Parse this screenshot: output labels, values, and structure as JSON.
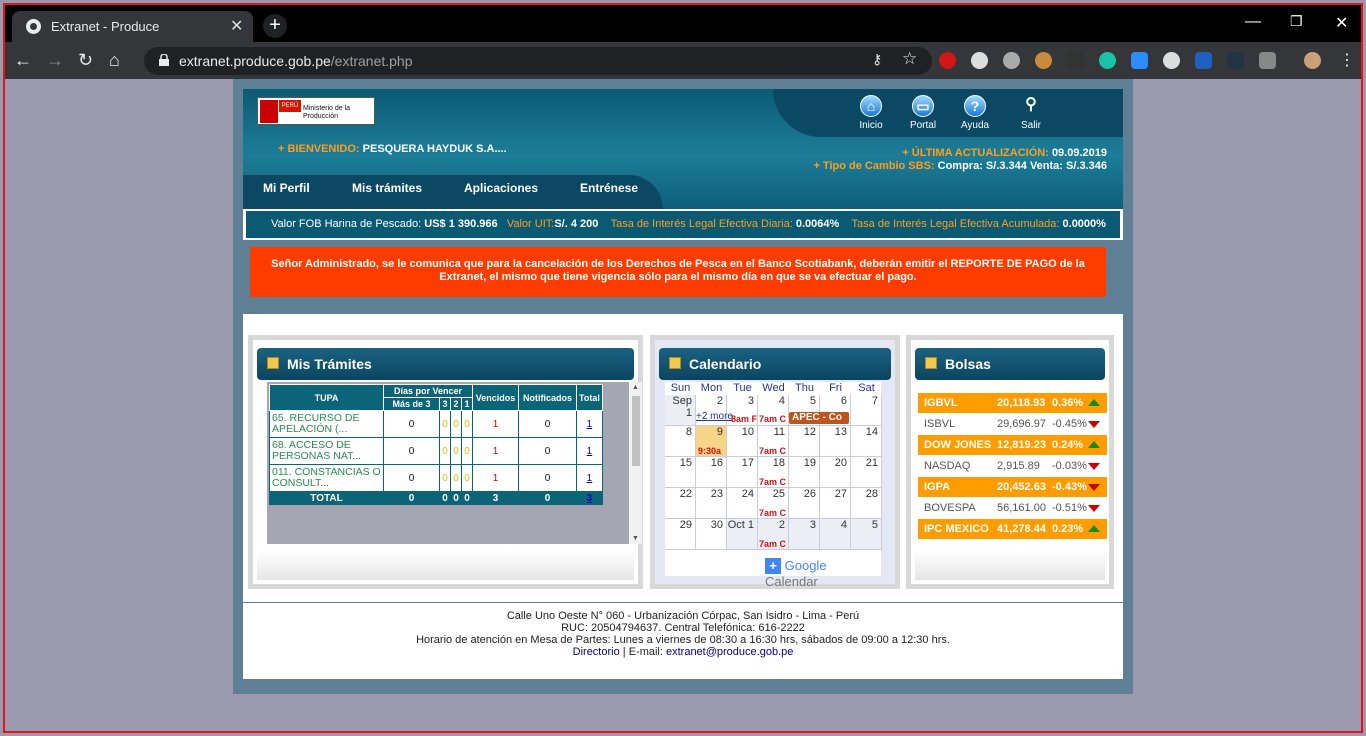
{
  "browser": {
    "tab_title": "Extranet - Produce",
    "url_host": "extranet.produce.gob.pe",
    "url_path": "/extranet.php"
  },
  "header": {
    "logo_text": "Ministerio de la Producción",
    "logo_country": "PERÚ",
    "icons": [
      {
        "label": "Inicio"
      },
      {
        "label": "Portal"
      },
      {
        "label": "Ayuda"
      },
      {
        "label": "Salir"
      }
    ],
    "welcome_prefix": "+ BIENVENIDO:",
    "welcome_name": "PESQUERA HAYDUK S.A....",
    "update_prefix": "+ ÚLTIMA ACTUALIZACIÓN:",
    "update_date": "09.09.2019",
    "fx_prefix": "+ Tipo de Cambio SBS:",
    "fx_value": "Compra: S/.3.344 Venta: S/.3.346"
  },
  "menu": [
    "Mi Perfil",
    "Mis trámites",
    "Aplicaciones",
    "Entrénese"
  ],
  "ticker": {
    "fob_label": "Valor FOB Harina de Pescado:",
    "fob_value": "US$ 1 390.966",
    "uit_label": "Valor UIT:",
    "uit_value": "S/. 4 200",
    "tasa1_label": "Tasa de Interés Legal Efectiva Diaria:",
    "tasa1_value": "0.0064%",
    "tasa2_label": "Tasa de Interés Legal Efectiva Acumulada:",
    "tasa2_value": "0.0000%"
  },
  "notice": "Señor Administrado, se le comunica que para la cancelación de los Derechos de Pesca en el Banco Scotiabank, deberán emitir el REPORTE DE PAGO de la Extranet, el mismo que tiene vigencia sólo para el mismo día en que se va efectuar el pago.",
  "tramites": {
    "title": "Mis Trámites",
    "headers": {
      "tupa": "TUPA",
      "dias": "Días por Vencer",
      "mas3": "Más de 3",
      "d3": "3",
      "d2": "2",
      "d1": "1",
      "vencidos": "Vencidos",
      "notificados": "Notificados",
      "total": "Total"
    },
    "rows": [
      {
        "name": "65. RECURSO DE APELACIÓN (...",
        "mas3": "0",
        "d3": "0",
        "d2": "0",
        "d1": "0",
        "venc": "1",
        "notif": "0",
        "total": "1"
      },
      {
        "name": "68. ACCESO DE PERSONAS NAT...",
        "mas3": "0",
        "d3": "0",
        "d2": "0",
        "d1": "0",
        "venc": "1",
        "notif": "0",
        "total": "1"
      },
      {
        "name": "011. CONSTANCIAS O CONSULT...",
        "mas3": "0",
        "d3": "0",
        "d2": "0",
        "d1": "0",
        "venc": "1",
        "notif": "0",
        "total": "1"
      }
    ],
    "totals": {
      "label": "TOTAL",
      "mas3": "0",
      "d3": "0",
      "d2": "0",
      "d1": "0",
      "venc": "3",
      "notif": "0",
      "total": "3"
    }
  },
  "calendario": {
    "title": "Calendario",
    "days": [
      "Sun",
      "Mon",
      "Tue",
      "Wed",
      "Thu",
      "Fri",
      "Sat"
    ],
    "weeks": [
      [
        "Sep 1",
        "2",
        "3",
        "4",
        "5",
        "6",
        "7"
      ],
      [
        "8",
        "9",
        "10",
        "11",
        "12",
        "13",
        "14"
      ],
      [
        "15",
        "16",
        "17",
        "18",
        "19",
        "20",
        "21"
      ],
      [
        "22",
        "23",
        "24",
        "25",
        "26",
        "27",
        "28"
      ],
      [
        "29",
        "30",
        "Oct 1",
        "2",
        "3",
        "4",
        "5"
      ]
    ],
    "events": {
      "more": "+2 more",
      "e1": "8am F",
      "e2": "7am C",
      "apec": "APEC - Co",
      "e930": "9:30a"
    },
    "google": "Google",
    "calendar": "Calendar"
  },
  "bolsas": {
    "title": "Bolsas",
    "rows": [
      {
        "name": "IGBVL",
        "value": "20,118.93",
        "pct": "0.36%",
        "dir": "up",
        "style": "o"
      },
      {
        "name": "ISBVL",
        "value": "29,696.97",
        "pct": "-0.45%",
        "dir": "dn",
        "style": "w"
      },
      {
        "name": "DOW JONES",
        "value": "12,819.23",
        "pct": "0.24%",
        "dir": "up",
        "style": "o"
      },
      {
        "name": "NASDAQ",
        "value": "2,915.89",
        "pct": "-0.03%",
        "dir": "dn",
        "style": "w"
      },
      {
        "name": "IGPA",
        "value": "20,452.63",
        "pct": "-0.43%",
        "dir": "dn",
        "style": "o"
      },
      {
        "name": "BOVESPA",
        "value": "56,161.00",
        "pct": "-0.51%",
        "dir": "dn",
        "style": "w"
      },
      {
        "name": "IPC MEXICO",
        "value": "41,278.44",
        "pct": "0.23%",
        "dir": "up",
        "style": "o"
      }
    ]
  },
  "footer": {
    "address": "Calle Uno Oeste N° 060 - Urbanización Córpac, San Isidro - Lima - Perú",
    "ruc": "RUC: 20504794637. Central Telefónica: 616-2222",
    "horario": "Horario de atención en Mesa de Partes: Lunes a viernes de 08:30 a 16:30 hrs, sábados de 09:00 a 12:30 hrs.",
    "directorio": "Directorio",
    "email_label": "| E-mail:",
    "email": "extranet@produce.gob.pe"
  }
}
